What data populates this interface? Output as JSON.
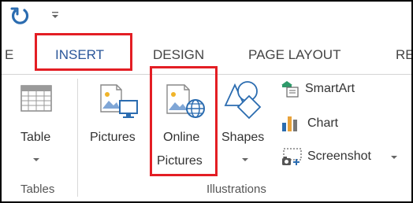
{
  "tabs": [
    {
      "label": "E"
    },
    {
      "label": "INSERT"
    },
    {
      "label": "DESIGN"
    },
    {
      "label": "PAGE LAYOUT"
    },
    {
      "label": "RE"
    }
  ],
  "groups": {
    "tables": {
      "label": "Tables",
      "table_button": "Table"
    },
    "illustrations": {
      "label": "Illustrations",
      "pictures_button": "Pictures",
      "online_pictures_line1": "Online",
      "online_pictures_line2": "Pictures",
      "shapes_button": "Shapes",
      "smartart_button": "SmartArt",
      "chart_button": "Chart",
      "screenshot_button": "Screenshot"
    }
  },
  "colors": {
    "highlight": "#e31e24",
    "active_tab": "#2b579a",
    "icon_blue": "#2b6cb0"
  }
}
